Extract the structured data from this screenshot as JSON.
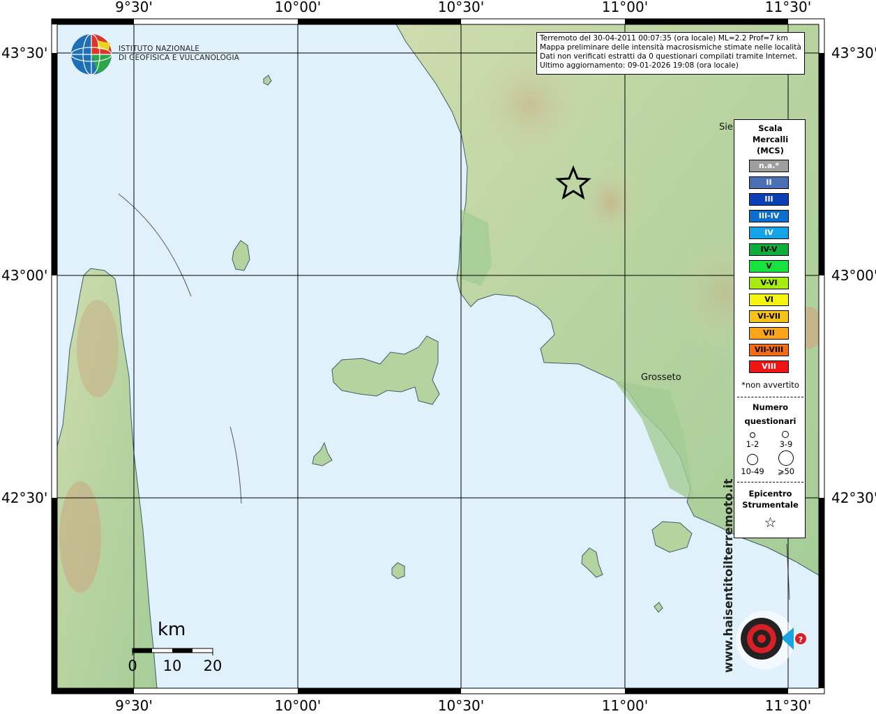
{
  "map": {
    "longitude_labels": [
      "9°30'",
      "10°00'",
      "10°30'",
      "11°00'",
      "11°30'"
    ],
    "latitude_labels": [
      "43°30'",
      "43°00'",
      "42°30'"
    ],
    "colors": {
      "sea": "#e0f1fc",
      "land_low": "#a9cf9c",
      "land_mid": "#cfdcae",
      "land_high": "#c9ae86",
      "coastline": "#3d5c6a"
    }
  },
  "info": {
    "line1": "Terremoto del 30-04-2011 00:07:35 (ora locale) ML=2.2 Prof=7 km",
    "line2": "Mappa preliminare delle intensità macrosismiche stimate nelle località",
    "line3": "Dati non verificati estratti da 0 questionari compilati tramite Internet.",
    "line4": "Ultimo aggiornamento: 09-01-2026 19:08 (ora locale)"
  },
  "logo": {
    "line1": "ISTITUTO NAZIONALE",
    "line2": "DI GEOFISICA E VULCANOLOGIA"
  },
  "places": {
    "siena": "Sie",
    "grosseto": "Grosseto"
  },
  "legend": {
    "title1": "Scala",
    "title2": "Mercalli",
    "title3": "(MCS)",
    "scale": [
      {
        "label": "n.a.*",
        "color": "#9e9e9e",
        "text_color": "#ffffff"
      },
      {
        "label": "II",
        "color": "#4a6fb5",
        "text_color": "#ffffff"
      },
      {
        "label": "III",
        "color": "#0a3fb6",
        "text_color": "#ffffff"
      },
      {
        "label": "III-IV",
        "color": "#0b6fce",
        "text_color": "#ffffff"
      },
      {
        "label": "IV",
        "color": "#16a4e8",
        "text_color": "#ffffff"
      },
      {
        "label": "IV-V",
        "color": "#0fad3c",
        "text_color": "#000000"
      },
      {
        "label": "V",
        "color": "#17e33e",
        "text_color": "#000000"
      },
      {
        "label": "V-VI",
        "color": "#a6ec12",
        "text_color": "#000000"
      },
      {
        "label": "VI",
        "color": "#f5f510",
        "text_color": "#000000"
      },
      {
        "label": "VI-VII",
        "color": "#f7c315",
        "text_color": "#000000"
      },
      {
        "label": "VII",
        "color": "#fba61a",
        "text_color": "#000000"
      },
      {
        "label": "VII-VIII",
        "color": "#f66b15",
        "text_color": "#000000"
      },
      {
        "label": "VIII",
        "color": "#ef1515",
        "text_color": "#ffffff"
      }
    ],
    "note": "*non avvertito",
    "quest_title1": "Numero",
    "quest_title2": "questionari",
    "quest_labels": [
      "1-2",
      "3-9",
      "10-49",
      "⩾50"
    ],
    "epi_title1": "Epicentro",
    "epi_title2": "Strumentale",
    "epi_symbol": "☆"
  },
  "scalebar": {
    "unit": "km",
    "ticks": [
      "0",
      "10",
      "20"
    ]
  },
  "watermark": {
    "text": "www.haisentitoilterremoto.it"
  }
}
